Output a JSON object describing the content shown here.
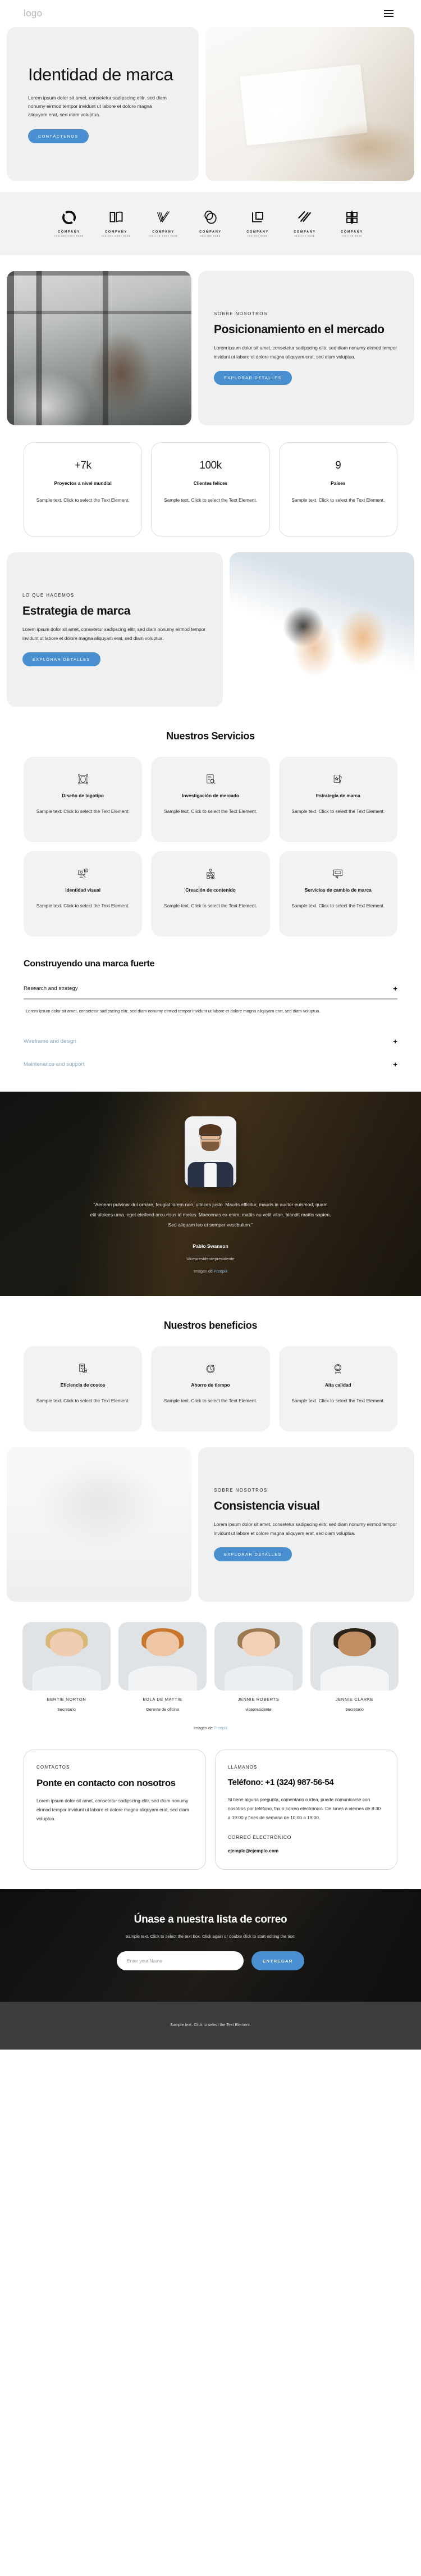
{
  "header": {
    "logo": "logo",
    "menu_icon": "hamburger-icon"
  },
  "hero": {
    "title": "Identidad de marca",
    "text": "Lorem ipsum dolor sit amet, consetetur sadipscing elitr, sed diam nonumy eirmod tempor invidunt ut labore et dolore magna aliquyam erat, sed diam voluptua.",
    "cta": "CONTÁCTENOS"
  },
  "clients": [
    {
      "name": "COMPANY",
      "tagline": "TAGLINE GOES HERE",
      "mark": "ring-logo-icon"
    },
    {
      "name": "COMPANY",
      "tagline": "TAGLINE GOES HERE",
      "mark": "book-logo-icon"
    },
    {
      "name": "COMPANY",
      "tagline": "TAGLINE GOES HERE",
      "mark": "check-lines-logo-icon"
    },
    {
      "name": "COMPANY",
      "tagline": "TAGLINE HERE",
      "mark": "double-circle-logo-icon"
    },
    {
      "name": "COMPANY",
      "tagline": "TAGLINE HERE",
      "mark": "square-corner-logo-icon"
    },
    {
      "name": "COMPANY",
      "tagline": "TAGLINE HERE",
      "mark": "slashes-logo-icon"
    },
    {
      "name": "COMPANY",
      "tagline": "TAGLINE HERE",
      "mark": "monogram-logo-icon"
    }
  ],
  "positioning": {
    "eyebrow": "SOBRE NOSOTROS",
    "title": "Posicionamiento en el mercado",
    "text": "Lorem ipsum dolor sit amet, consetetur sadipscing elitr, sed diam nonumy eirmod tempor invidunt ut labore et dolore magna aliquyam erat, sed diam voluptua.",
    "cta": "EXPLORAR DETALLES"
  },
  "stats": [
    {
      "value": "+7k",
      "label": "Proyectos a nivel mundial",
      "text": "Sample text. Click to select the Text Element."
    },
    {
      "value": "100k",
      "label": "Clientes felices",
      "text": "Sample text. Click to select the Text Element."
    },
    {
      "value": "9",
      "label": "Países",
      "text": "Sample text. Click to select the Text Element."
    }
  ],
  "strategy": {
    "eyebrow": "LO QUE HACEMOS",
    "title": "Estrategia de marca",
    "text": "Lorem ipsum dolor sit amet, consetetur sadipscing elitr, sed diam nonumy eirmod tempor invidunt ut labore et dolore magna aliquyam erat, sed diam voluptua.",
    "cta": "EXPLORAR DETALLES"
  },
  "services": {
    "heading": "Nuestros Servicios",
    "items": [
      {
        "icon": "logo-design-icon",
        "title": "Diseño de logotipo",
        "text": "Sample text. Click to select the Text Element."
      },
      {
        "icon": "market-research-icon",
        "title": "Investigación de mercado",
        "text": "Sample text. Click to select the Text Element."
      },
      {
        "icon": "brand-strategy-icon",
        "title": "Estrategia de marca",
        "text": "Sample text. Click to select the Text Element."
      },
      {
        "icon": "visual-identity-icon",
        "title": "Identidad visual",
        "text": "Sample text. Click to select the Text Element."
      },
      {
        "icon": "content-creation-icon",
        "title": "Creación de contenido",
        "text": "Sample text. Click to select the Text Element."
      },
      {
        "icon": "rebranding-icon",
        "title": "Servicios de cambio de marca",
        "text": "Sample text. Click to select the Text Element."
      }
    ]
  },
  "accordion": {
    "heading": "Construyendo una marca fuerte",
    "items": [
      {
        "label": "Research and strategy",
        "open": true,
        "body": "Lorem ipsum dolor sit amet, consetetur sadipscing elitr, sed diam nonumy eirmod tempor invidunt ut labore et dolore magna aliquyam erat, sed diam voluptua.",
        "toggle": "+"
      },
      {
        "label": "Wireframe and design",
        "open": false,
        "body": "",
        "toggle": "+"
      },
      {
        "label": "Maintenance and support",
        "open": false,
        "body": "",
        "toggle": "+"
      }
    ]
  },
  "testimonial": {
    "quote": "\"Aenean pulvinar dui ornare, feugiat lorem non, ultrices justo. Mauris efficitur, mauris in auctor euismod, quam elit ultrices urna, eget eleifend arcu risus id metus. Maecenas ex enim, mattis eu velit vitae, blandit mattis sapien. Sed aliquam leo et semper vestibulum.\"",
    "name": "Pablo Swanson",
    "role": "Vicepresidentepresidente",
    "credit_prefix": "Imagen de ",
    "credit_link": "Freepik"
  },
  "benefits": {
    "heading": "Nuestros beneficios",
    "items": [
      {
        "icon": "cost-efficiency-icon",
        "title": "Eficiencia de costos",
        "text": "Sample text. Click to select the Text Element."
      },
      {
        "icon": "time-saving-icon",
        "title": "Ahorro de tiempo",
        "text": "Sample text. Click to select the Text Element."
      },
      {
        "icon": "high-quality-icon",
        "title": "Alta calidad",
        "text": "Sample text. Click to select the Text Element."
      }
    ]
  },
  "consistency": {
    "eyebrow": "SOBRE NOSOTROS",
    "title": "Consistencia visual",
    "text": "Lorem ipsum dolor sit amet, consetetur sadipscing elitr, sed diam nonumy eirmod tempor invidunt ut labore et dolore magna aliquyam erat, sed diam voluptua.",
    "cta": "EXPLORAR DETALLES"
  },
  "team": {
    "members": [
      {
        "name": "BERTIE NORTON",
        "role": "Secretario"
      },
      {
        "name": "BOLA DE MATTIE",
        "role": "Gerente de oficina"
      },
      {
        "name": "JENNIE ROBERTS",
        "role": "vicepresidente"
      },
      {
        "name": "JENNIE CLARKE",
        "role": "Secretario"
      }
    ],
    "credit_prefix": "Imagen de ",
    "credit_link": "Freepik"
  },
  "contact": {
    "left": {
      "eyebrow": "CONTACTOS",
      "title": "Ponte en contacto con nosotros",
      "text": "Lorem ipsum dolor sit amet, consetetur sadipscing elitr, sed diam nonumy eirmod tempor invidunt ut labore et dolore magna aliquyam erat, sed diam voluptua."
    },
    "right": {
      "eyebrow": "LLÁMANOS",
      "title": "Teléfono: +1 (324) 987-56-54",
      "text": "Si tiene alguna pregunta, comentario o idea, puede comunicarse con nosotros por teléfono, fax o correo electrónico. De lunes a viernes de 8:30 a 19:00 y fines de semana de 10:00 a 19:00.",
      "email_label": "CORREO ELECTRÓNICO",
      "email": "ejemplo@ejemplo.com"
    }
  },
  "newsletter": {
    "title": "Únase a nuestra lista de correo",
    "subtitle": "Sample text. Click to select the text box. Click again or double click to start editing the text.",
    "placeholder": "Enter your Name",
    "button": "ENTREGAR"
  },
  "footer": {
    "text": "Sample text. Click to select the Text Element."
  },
  "colors": {
    "accent": "#4a90d0",
    "card_bg": "#f2f2f2",
    "hero_bg": "#f0f0f0",
    "footer_bg": "#3c3c3c",
    "link": "#88b3d8"
  }
}
